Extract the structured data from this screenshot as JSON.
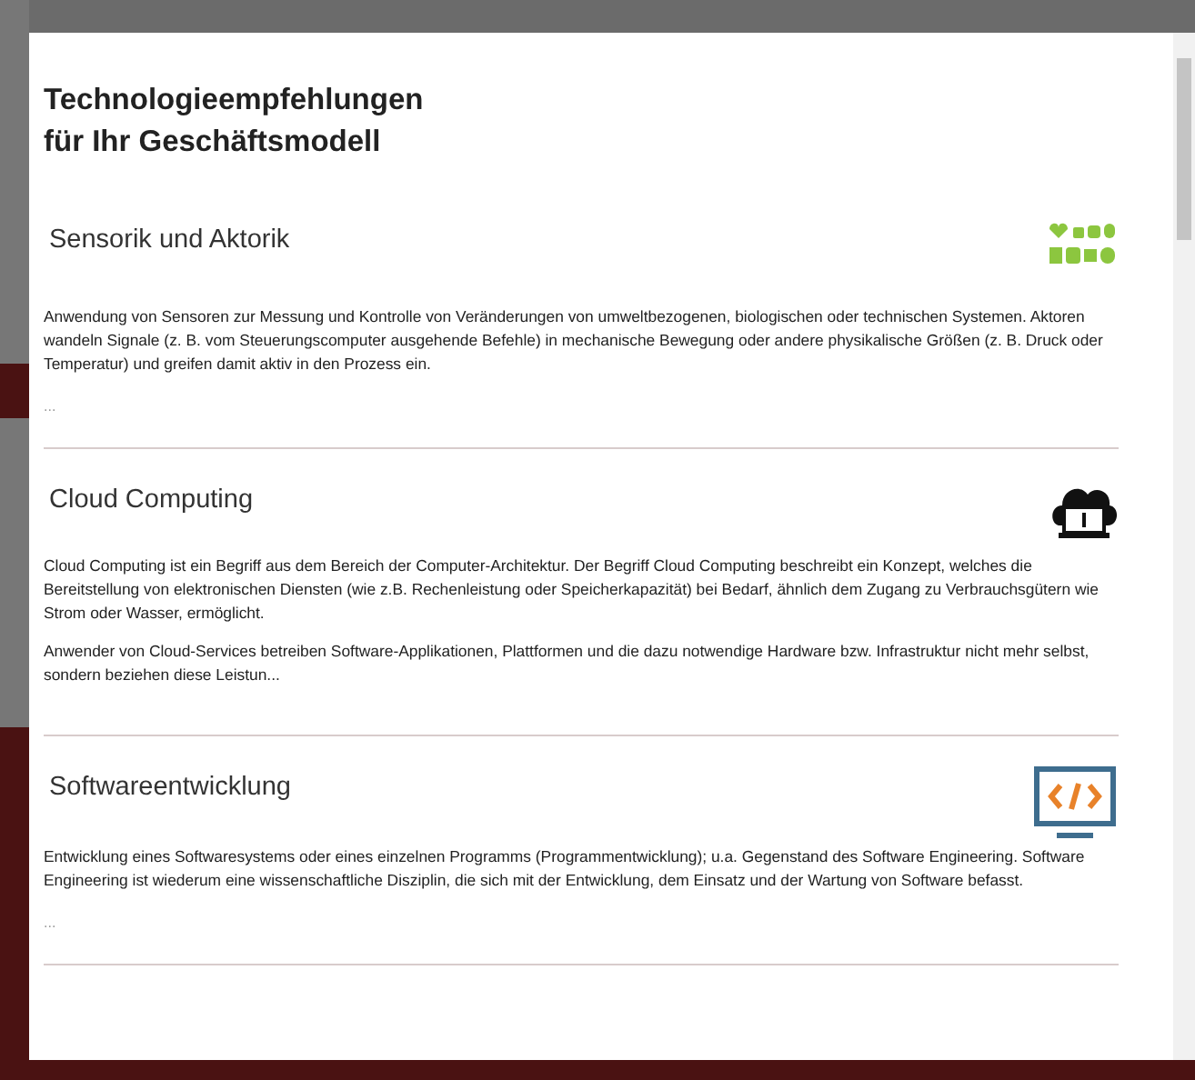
{
  "dialog": {
    "title_lines": [
      "Technologieempfehlungen",
      "für Ihr Geschäftsmodell"
    ]
  },
  "sections": [
    {
      "heading": "Sensorik und Aktorik",
      "paragraphs": [
        "Anwendung von Sensoren zur Messung und Kontrolle von Veränderungen von umweltbezogenen, biologischen oder technischen Systemen. Aktoren wandeln Signale (z. B. vom Steuerungscomputer ausgehende Befehle) in mechanische Bewegung oder andere physikalische Größen (z. B. Druck oder Temperatur) und greifen damit aktiv in den Prozess ein."
      ],
      "more": "..."
    },
    {
      "heading": "Cloud Computing",
      "paragraphs": [
        "Cloud Computing ist ein Begriff aus dem Bereich der Computer-Architektur. Der Begriff Cloud Computing beschreibt ein Konzept, welches die Bereitstellung von elektronischen Diensten (wie z.B. Rechenleistung oder Speicherkapazität) bei Bedarf, ähnlich dem Zugang zu Verbrauchsgütern wie Strom oder Wasser, ermöglicht.",
        "Anwender von Cloud-Services betreiben Software-Applikationen, Plattformen und die dazu notwendige Hardware bzw. Infrastruktur nicht mehr selbst, sondern beziehen diese Leistun..."
      ]
    },
    {
      "heading": "Softwareentwicklung",
      "paragraphs": [
        "Entwicklung eines Softwaresystems oder eines einzelnen Programms (Programmentwicklung); u.a. Gegenstand des Software Engineering. Software Engineering ist wiederum eine wissenschaftliche Disziplin, die sich mit der Entwicklung, dem Einsatz und der Wartung von Software befasst."
      ],
      "more": "..."
    }
  ]
}
